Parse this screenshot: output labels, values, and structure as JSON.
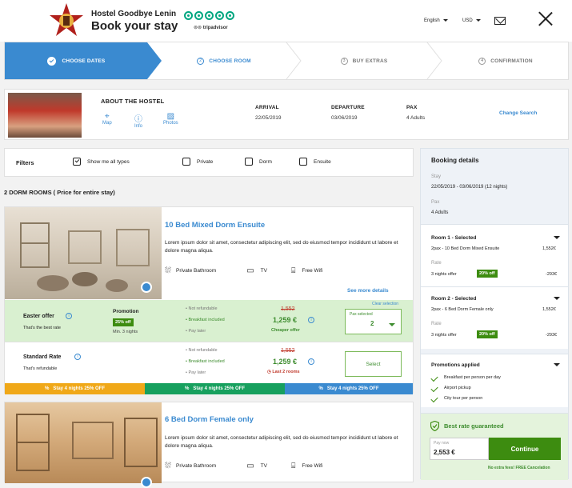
{
  "header": {
    "hostel_name": "Hostel Goodbye Lenin",
    "title": "Book your stay",
    "tripadvisor": "tripadvisor",
    "language": "English",
    "currency": "USD"
  },
  "steps": [
    {
      "num": "",
      "label": "CHOOSE DATES"
    },
    {
      "num": "2",
      "label": "CHOOSE ROOM"
    },
    {
      "num": "3",
      "label": "BUY EXTRAS"
    },
    {
      "num": "4",
      "label": "CONFIRMATION"
    }
  ],
  "hostel": {
    "about": "ABOUT THE HOSTEL",
    "links": [
      "Map",
      "Info",
      "Photos"
    ],
    "arrival_label": "ARRIVAL",
    "arrival": "22/05/2019",
    "departure_label": "DEPARTURE",
    "departure": "03/06/2019",
    "pax_label": "PAX",
    "pax": "4 Adults",
    "change": "Change Search"
  },
  "filters": {
    "title": "Filters",
    "options": [
      "Show me all types",
      "Private",
      "Dorm",
      "Ensuite"
    ]
  },
  "section_title": "2 DORM ROOMS ( Price for entire stay)",
  "room1": {
    "name": "10 Bed Mixed Dorm Ensuite",
    "desc": "Lorem ipsum dolor sit amet, consectetur adipiscing elit, sed do eiusmod tempor incididunt ut labore et dolore magna aliqua.",
    "amenities": [
      "Private Bathroom",
      "TV",
      "Free Wifi"
    ],
    "see_more": "See more details"
  },
  "offer1": {
    "name": "Easter offer",
    "sub": "That's the best rate",
    "promo": "Promotion",
    "promo_badge": "25% off",
    "promo_min": "Min. 3 nights",
    "features": [
      "Not refundable",
      "Breakfast included",
      "Pay later"
    ],
    "old_price": "1,552",
    "price": "1,259 €",
    "cheaper": "Cheaper offer",
    "clear": "Clear selection",
    "pax_selected": "Pax selected",
    "pax_value": "2"
  },
  "offer2": {
    "name": "Standard Rate",
    "sub": "That's refundable",
    "features": [
      "Not refundable",
      "Breakfast included",
      "Pay later"
    ],
    "old_price": "1,552",
    "price": "1,259 €",
    "last": "Last 2 rooms",
    "select": "Select"
  },
  "strips": [
    "Stay 4 nights 25% OFF",
    "Stay 4 nights 25% OFF",
    "Stay 4 nights 25% OFF"
  ],
  "room2": {
    "name": "6 Bed Dorm Female only",
    "desc": "Lorem ipsum dolor sit amet, consectetur adipiscing elit, sed do eiusmod tempor incididunt ut labore et dolore magna aliqua.",
    "amenities": [
      "Private Bathroom",
      "TV",
      "Free Wifi"
    ]
  },
  "booking": {
    "title": "Booking details",
    "stay_label": "Stay",
    "stay": "22/05/2019 - 03/06/2019 (12 nights)",
    "pax_label": "Pax",
    "pax": "4 Adults",
    "r1_title": "Room 1 - Selected",
    "r1_desc": "2pax - 10 Bed Dorm Mixed Ensuite",
    "r1_price": "1,552€",
    "r1_rate_label": "Rate",
    "r1_rate": "3 nights offer",
    "r1_badge": "20% off",
    "r1_disc": "-293€",
    "r2_title": "Room 2 - Selected",
    "r2_desc": "2pax - 6 Bed Dorm Female only",
    "r2_price": "1,552€",
    "r2_rate_label": "Rate",
    "r2_rate": "3 nights offer",
    "r2_badge": "20% off",
    "r2_disc": "-293€",
    "promos_title": "Promotions applied",
    "promos": [
      "Breakfast per person per day",
      "Airport pickup",
      "City tour per person"
    ],
    "best_rate": "Best rate guaranteed",
    "pay_now_label": "Pay now",
    "pay_now": "2,553 €",
    "continue": "Continue",
    "no_fees": "No extra fees! FREE Cancelation"
  }
}
